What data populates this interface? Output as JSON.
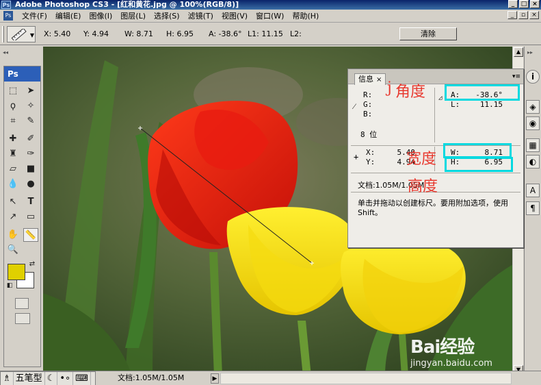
{
  "window": {
    "title": "Adobe Photoshop CS3 - [红和黄花.jpg @ 100%(RGB/8)]",
    "app_icon_text": "Ps",
    "controls": [
      "minimize",
      "maximize",
      "close"
    ],
    "doc_controls": [
      "minimize",
      "restore",
      "close"
    ]
  },
  "menu": {
    "items": [
      "文件(F)",
      "编辑(E)",
      "图像(I)",
      "图层(L)",
      "选择(S)",
      "滤镜(T)",
      "视图(V)",
      "窗口(W)",
      "帮助(H)"
    ]
  },
  "options": {
    "tool_icon": "ruler-icon",
    "x": "X: 5.40",
    "y": "Y: 4.94",
    "w": "W: 8.71",
    "h": "H: 6.95",
    "a": "A: -38.6°",
    "l1": "L1: 11.15",
    "l2": "L2:",
    "clear_label": "清除"
  },
  "toolbox": {
    "badge": "Ps",
    "tools": [
      "marquee-icon",
      "move-icon",
      "lasso-icon",
      "magic-wand-icon",
      "crop-icon",
      "slice-icon",
      "healing-brush-icon",
      "brush-icon",
      "clone-stamp-icon",
      "history-brush-icon",
      "eraser-icon",
      "gradient-icon",
      "blur-icon",
      "dodge-icon",
      "path-select-icon",
      "type-icon",
      "direct-select-icon",
      "shape-icon",
      "hand-icon",
      "ruler-icon",
      "zoom-icon"
    ],
    "active_tool": "ruler-icon",
    "foreground_color": "#e0d000",
    "background_color": "#ffffff"
  },
  "info": {
    "tab_label": "信息",
    "rgb_labels": [
      "R:",
      "G:",
      "B:"
    ],
    "bit_depth": "8 位",
    "a_label": "A:",
    "a_value": "-38.6°",
    "l_label": "L:",
    "l_value": "11.15",
    "x_label": "X:",
    "x_value": "5.40",
    "y_label": "Y:",
    "y_value": "4.94",
    "w_label": "W:",
    "w_value": "8.71",
    "h_label": "H:",
    "h_value": "6.95",
    "doc_size": "文档:1.05M/1.05M",
    "hint": "单击并拖动以创建标尺。要用附加选项，使用 Shift。"
  },
  "annotations": {
    "angle": "角度",
    "width": "宽度",
    "height": "高度",
    "stray_char": "j",
    "box_color": "#00d9e0",
    "text_color": "#e83a30"
  },
  "statusbar": {
    "ime_mode": "五笔型",
    "doc_status": "文档:1.05M/1.05M"
  },
  "watermark": {
    "brand": "Bai经验",
    "site": "jingyan.baidu.com"
  }
}
